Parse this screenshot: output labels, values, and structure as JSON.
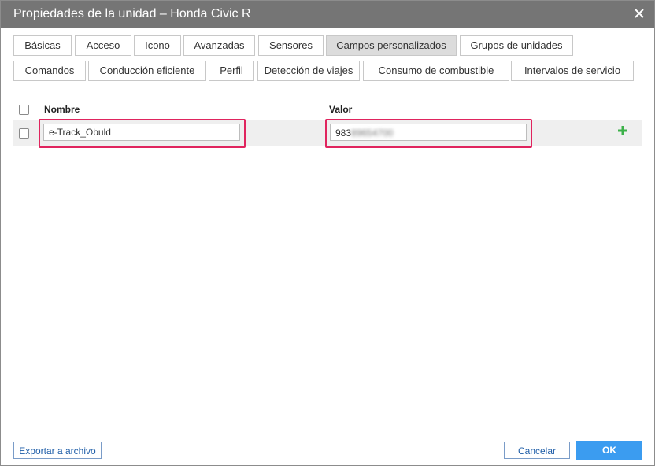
{
  "dialog": {
    "title": "Propiedades de la unidad – Honda Civic R"
  },
  "tabs": {
    "row1": [
      "Básicas",
      "Acceso",
      "Icono",
      "Avanzadas",
      "Sensores",
      "Campos personalizados",
      "Grupos de unidades"
    ],
    "row2": [
      "Comandos",
      "Conducción eficiente",
      "Perfil",
      "Detección de viajes",
      "Consumo de combustible",
      "Intervalos de servicio"
    ],
    "active": "Campos personalizados"
  },
  "table": {
    "col_name": "Nombre",
    "col_value": "Valor",
    "rows": [
      {
        "name": "e-Track_Obuld",
        "value_visible": "983",
        "value_blurred": "89654700"
      }
    ]
  },
  "buttons": {
    "export": "Exportar a archivo",
    "cancel": "Cancelar",
    "ok": "OK"
  },
  "colors": {
    "titlebar": "#757575",
    "highlight": "#e0245e",
    "add": "#3cb14a",
    "primary": "#3b9cf0"
  },
  "icons": {
    "close": "close-icon",
    "add": "plus-icon"
  }
}
